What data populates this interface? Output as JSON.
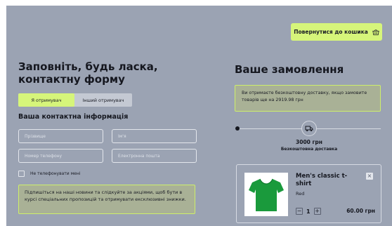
{
  "header": {
    "back_to_cart": "Повернутися до кошика",
    "cart_icon": "basket-icon"
  },
  "form": {
    "title": "Заповніть, будь ласка, контактну форму",
    "toggle": {
      "active": "Я отримувач",
      "inactive": "Інший отримувач"
    },
    "contact_heading": "Ваша контактна інформація",
    "fields": {
      "surname_placeholder": "Прізвище",
      "name_placeholder": "Ім'я",
      "phone_placeholder": "Номер телефону",
      "email_placeholder": "Електронна пошта"
    },
    "no_call_label": "Не телефонувати мені",
    "subscribe_text": "Підпишіться на наші новини та слідкуйте за акціями, щоб бути в курсі спеціальних пропозицій та отримувати ексклюзивні знижки."
  },
  "order": {
    "title": "Ваше замовлення",
    "free_delivery_note": "Ви отримаєте безкоштовну доставку, якщо замовите товарів ще на 2919.98 грн",
    "delivery": {
      "amount": "3000 грн",
      "label": "Безкоштовна доставка",
      "icon": "truck-icon"
    },
    "item": {
      "name": "Men's classic t-shirt",
      "color": "Red",
      "quantity": "1",
      "price": "60.00 грн",
      "remove": "×",
      "minus": "−",
      "plus": "+"
    }
  },
  "colors": {
    "background": "#9ba3b3",
    "accent": "#d6f57a",
    "product": "#1a9a3c"
  }
}
